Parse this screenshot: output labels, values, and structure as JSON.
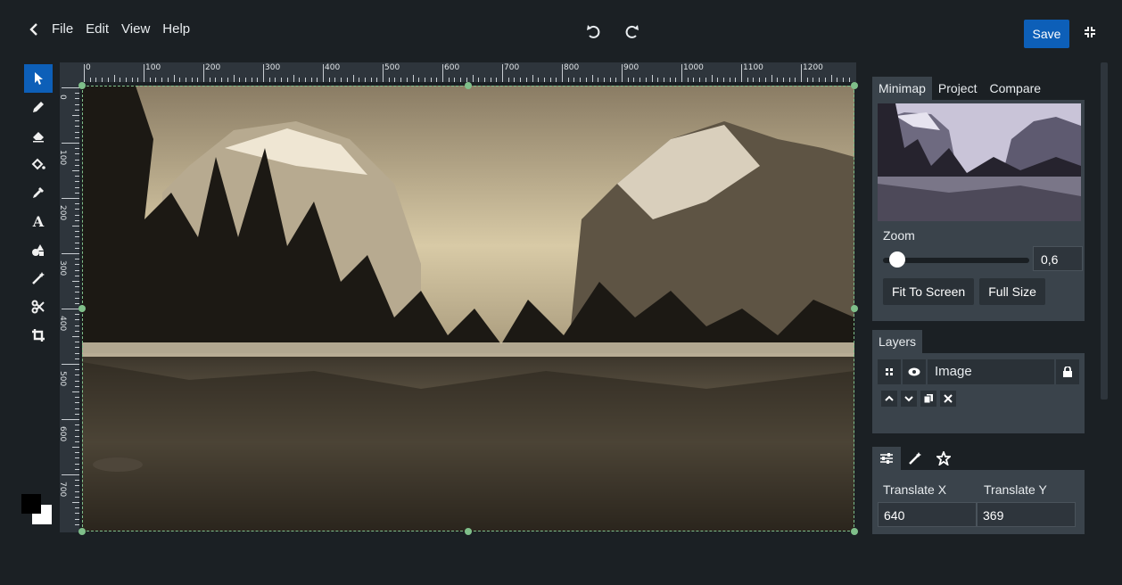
{
  "menu": {
    "items": [
      "File",
      "Edit",
      "View",
      "Help"
    ]
  },
  "toolbar": {
    "save_label": "Save",
    "undo_icon": "undo-icon",
    "redo_icon": "redo-icon"
  },
  "tools": [
    {
      "name": "select-tool",
      "icon": "pointer-icon",
      "active": true
    },
    {
      "name": "pencil-tool",
      "icon": "pencil-icon"
    },
    {
      "name": "eraser-tool",
      "icon": "eraser-icon"
    },
    {
      "name": "fill-tool",
      "icon": "paint-bucket-icon"
    },
    {
      "name": "eyedropper-tool",
      "icon": "eyedropper-icon"
    },
    {
      "name": "text-tool",
      "icon": "text-icon",
      "glyph": "A"
    },
    {
      "name": "shapes-tool",
      "icon": "shapes-icon"
    },
    {
      "name": "magic-tool",
      "icon": "magic-wand-icon"
    },
    {
      "name": "cut-tool",
      "icon": "scissors-icon"
    },
    {
      "name": "crop-tool",
      "icon": "crop-icon"
    }
  ],
  "colors": {
    "foreground": "#000000",
    "background": "#ffffff",
    "accent": "#0d5fb8",
    "selection": "#7fbf8a"
  },
  "ruler": {
    "horizontal": [
      "0",
      "100",
      "200",
      "300",
      "400",
      "500",
      "600",
      "700",
      "800",
      "900",
      "1000",
      "1100",
      "1200"
    ],
    "vertical": [
      "0",
      "100",
      "200",
      "300",
      "400",
      "500",
      "600",
      "700"
    ]
  },
  "right_panel": {
    "tabs": [
      "Minimap",
      "Project",
      "Compare"
    ],
    "zoom_label": "Zoom",
    "zoom_value": "0,6",
    "zoom_level": 0.05,
    "fit_to_screen": "Fit To Screen",
    "full_size": "Full Size",
    "layers_tab": "Layers",
    "layer": {
      "name": "Image"
    },
    "translate_x_label": "Translate X",
    "translate_y_label": "Translate Y",
    "translate_x": "640",
    "translate_y": "369"
  }
}
